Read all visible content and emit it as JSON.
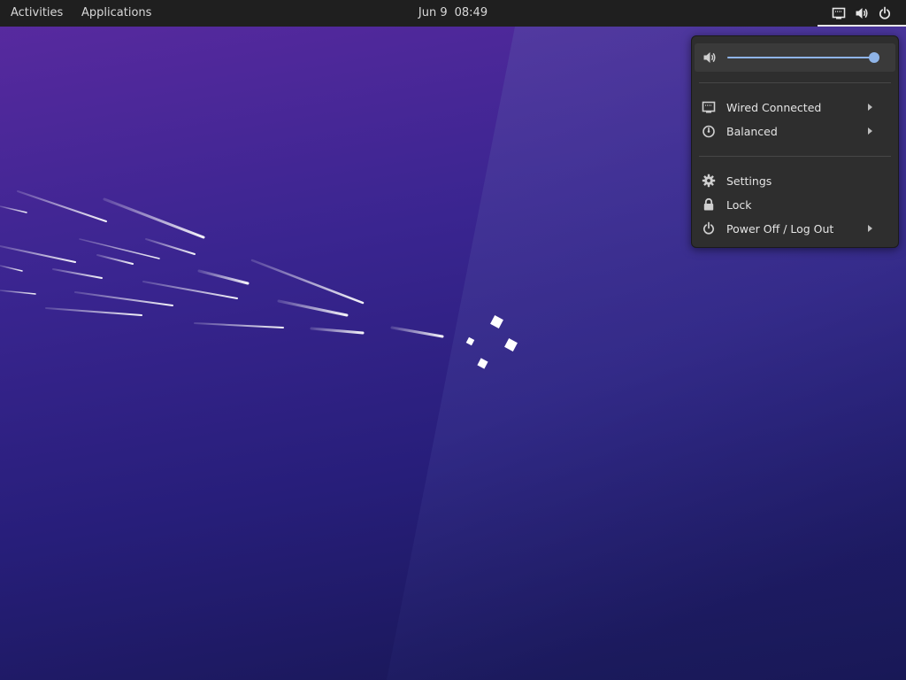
{
  "topbar": {
    "activities_label": "Activities",
    "applications_label": "Applications",
    "clock_date": "Jun 9",
    "clock_time": "08:49",
    "status_icons": [
      "network-wired-icon",
      "volume-icon",
      "power-icon"
    ]
  },
  "system_menu": {
    "volume": {
      "icon": "volume-icon",
      "level": 1.0
    },
    "items": [
      {
        "label": "Wired Connected",
        "icon": "network-wired-icon",
        "has_submenu": true
      },
      {
        "label": "Balanced",
        "icon": "power-profile-icon",
        "has_submenu": true
      },
      {
        "label": "Settings",
        "icon": "gear-icon",
        "has_submenu": false
      },
      {
        "label": "Lock",
        "icon": "lock-icon",
        "has_submenu": false
      },
      {
        "label": "Power Off / Log Out",
        "icon": "power-icon",
        "has_submenu": true
      }
    ]
  },
  "colors": {
    "topbar_bg": "#1f1f1f",
    "menu_bg": "#2e2e2e",
    "slider_accent": "#8fb4e8",
    "wallpaper_top": "#5a2aa0",
    "wallpaper_bottom": "#161650"
  }
}
